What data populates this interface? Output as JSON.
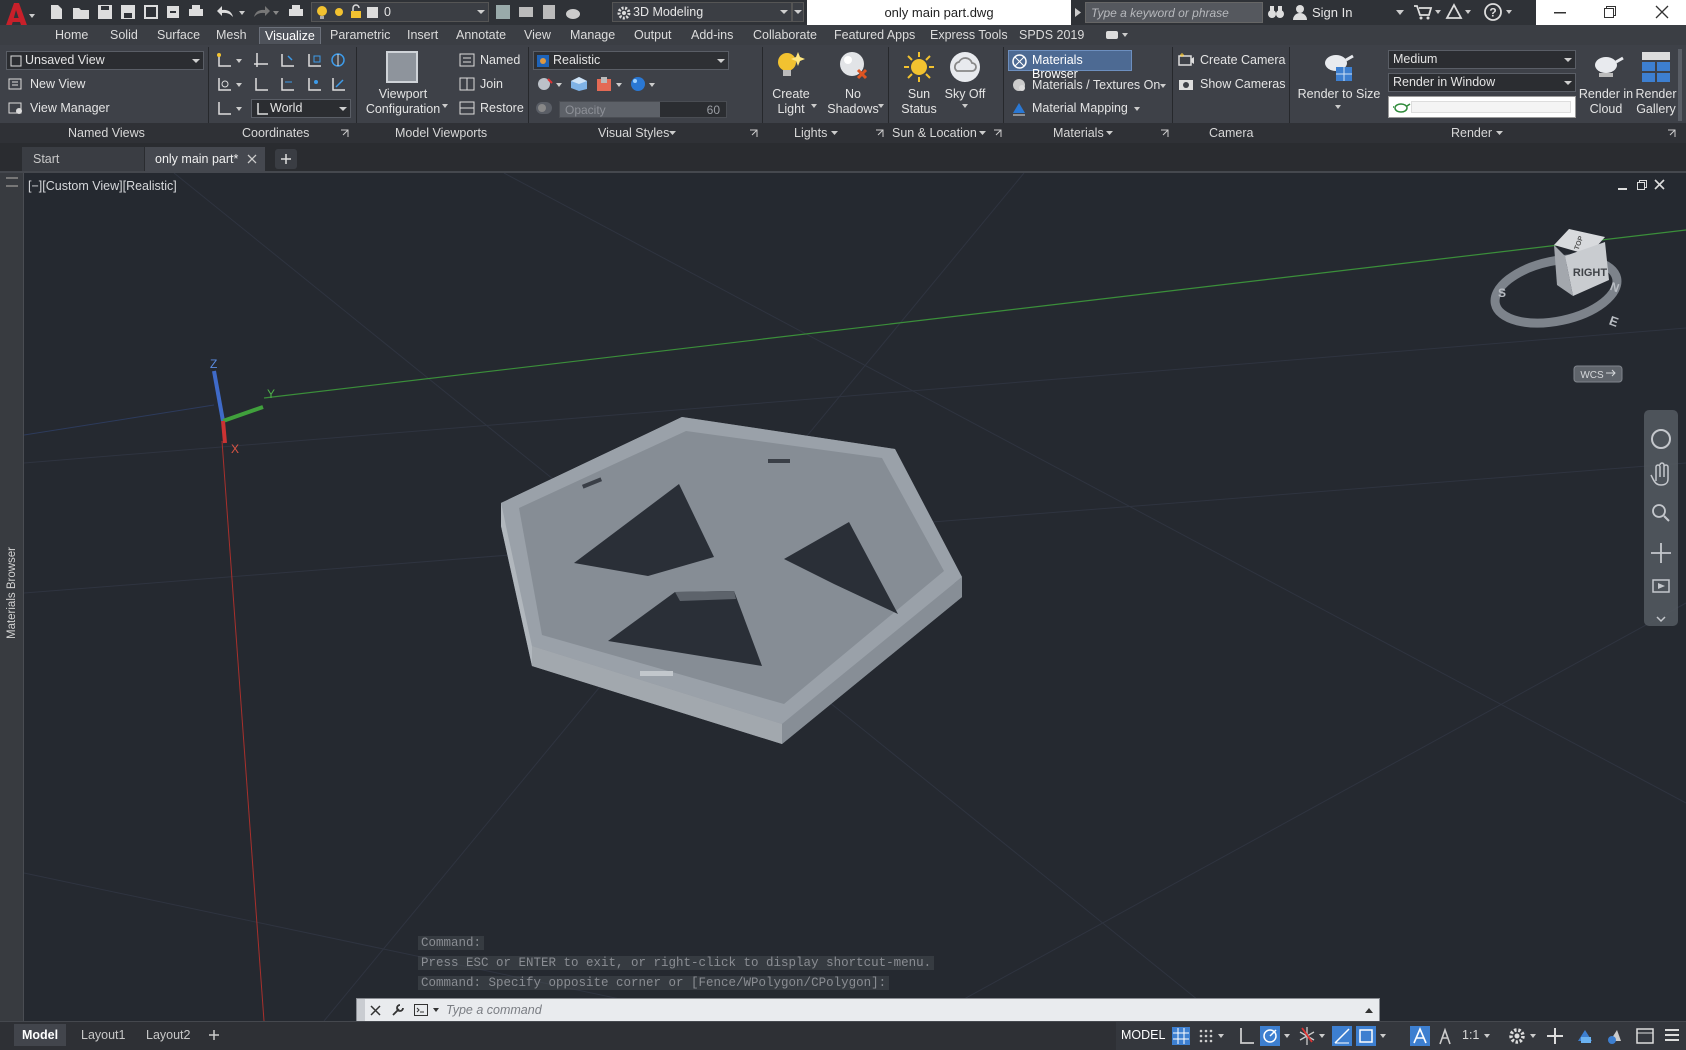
{
  "titlebar": {
    "workspace": "3D Modeling",
    "layer": "0",
    "doc_title": "only main part.dwg",
    "search_placeholder": "Type a keyword or phrase",
    "sign_in": "Sign In"
  },
  "menu_tabs": [
    "Home",
    "Solid",
    "Surface",
    "Mesh",
    "Visualize",
    "Parametric",
    "Insert",
    "Annotate",
    "View",
    "Manage",
    "Output",
    "Add-ins",
    "Collaborate",
    "Featured Apps",
    "Express Tools",
    "SPDS 2019"
  ],
  "active_tab": "Visualize",
  "ribbon": {
    "named_views": {
      "combo": "Unsaved View",
      "new_view": "New View",
      "view_manager": "View Manager",
      "title": "Named Views"
    },
    "coordinates": {
      "ucs_combo": "World",
      "title": "Coordinates"
    },
    "model_viewports": {
      "viewport_config_line1": "Viewport",
      "viewport_config_line2": "Configuration",
      "named": "Named",
      "join": "Join",
      "restore": "Restore",
      "title": "Model Viewports"
    },
    "visual_styles": {
      "combo": "Realistic",
      "opacity_label": "Opacity",
      "opacity_value": "60",
      "opacity_fraction": 0.6,
      "title": "Visual Styles"
    },
    "lights": {
      "create_light_1": "Create",
      "create_light_2": "Light",
      "no_shadows_1": "No",
      "no_shadows_2": "Shadows",
      "title": "Lights"
    },
    "sun_location": {
      "sun_status_1": "Sun",
      "sun_status_2": "Status",
      "sky_off_1": "Sky Off",
      "title": "Sun & Location"
    },
    "materials": {
      "browser": "Materials Browser",
      "textures": "Materials / Textures On",
      "mapping": "Material Mapping",
      "title": "Materials"
    },
    "camera": {
      "create": "Create Camera",
      "show": "Show  Cameras",
      "title": "Camera"
    },
    "render": {
      "render_size": "Render to Size",
      "quality": "Medium",
      "render_in": "Render in Window",
      "cloud_1": "Render in",
      "cloud_2": "Cloud",
      "gallery_1": "Render",
      "gallery_2": "Gallery",
      "title": "Render"
    }
  },
  "doc_tabs": {
    "start": "Start",
    "current": "only main part*"
  },
  "sidebar": {
    "label": "Materials Browser"
  },
  "viewport": {
    "label": "[−][Custom View][Realistic]",
    "viewcube_face": "RIGHT",
    "viewcube_top": "TOP",
    "compass": {
      "s": "S",
      "n": "N",
      "e": "E"
    },
    "wcs": "WCS",
    "axes": {
      "x": "X",
      "y": "Y",
      "z": "Z"
    }
  },
  "command_history": [
    "Command:",
    "Press ESC or ENTER to exit, or right-click to display shortcut-menu.",
    "Command: Specify opposite corner or [Fence/WPolygon/CPolygon]:"
  ],
  "command_placeholder": "Type a command",
  "layout_tabs": [
    "Model",
    "Layout1",
    "Layout2"
  ],
  "status": {
    "model": "MODEL",
    "scale": "1:1"
  },
  "colors": {
    "brand_red": "#c8202a",
    "ribbon_bg": "#3e4148",
    "viewport_bg": "#252930",
    "accent_blue": "#3d7fd0",
    "model_gray": "#9aa1a9"
  }
}
